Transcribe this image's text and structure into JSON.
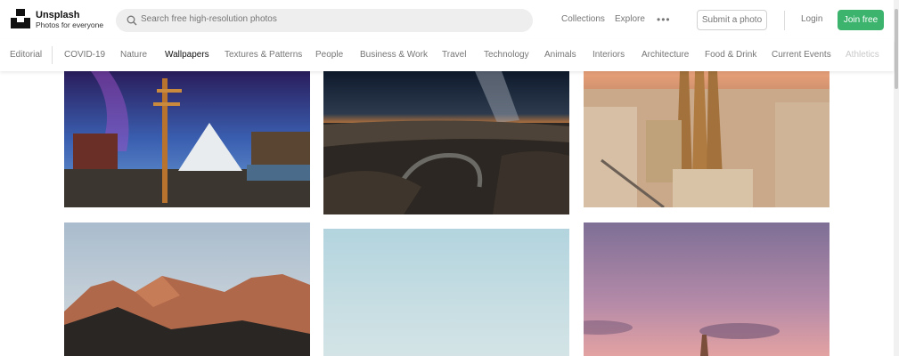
{
  "header": {
    "brand_name": "Unsplash",
    "brand_tagline": "Photos for everyone",
    "search_placeholder": "Search free high-resolution photos",
    "nav": [
      "Collections",
      "Explore"
    ],
    "submit_label": "Submit a photo",
    "login_label": "Login",
    "join_label": "Join free"
  },
  "topics": {
    "editorial": "Editorial",
    "items": [
      "COVID-19",
      "Nature",
      "Wallpapers",
      "Textures & Patterns",
      "People",
      "Business & Work",
      "Travel",
      "Technology",
      "Animals",
      "Interiors",
      "Architecture",
      "Food & Drink",
      "Current Events",
      "Athletics"
    ],
    "active": "Wallpapers"
  },
  "icons": [
    "logo-icon",
    "search-icon",
    "more-icon"
  ],
  "colors": {
    "accent": "#3cb46e",
    "muted_text": "#767676"
  }
}
